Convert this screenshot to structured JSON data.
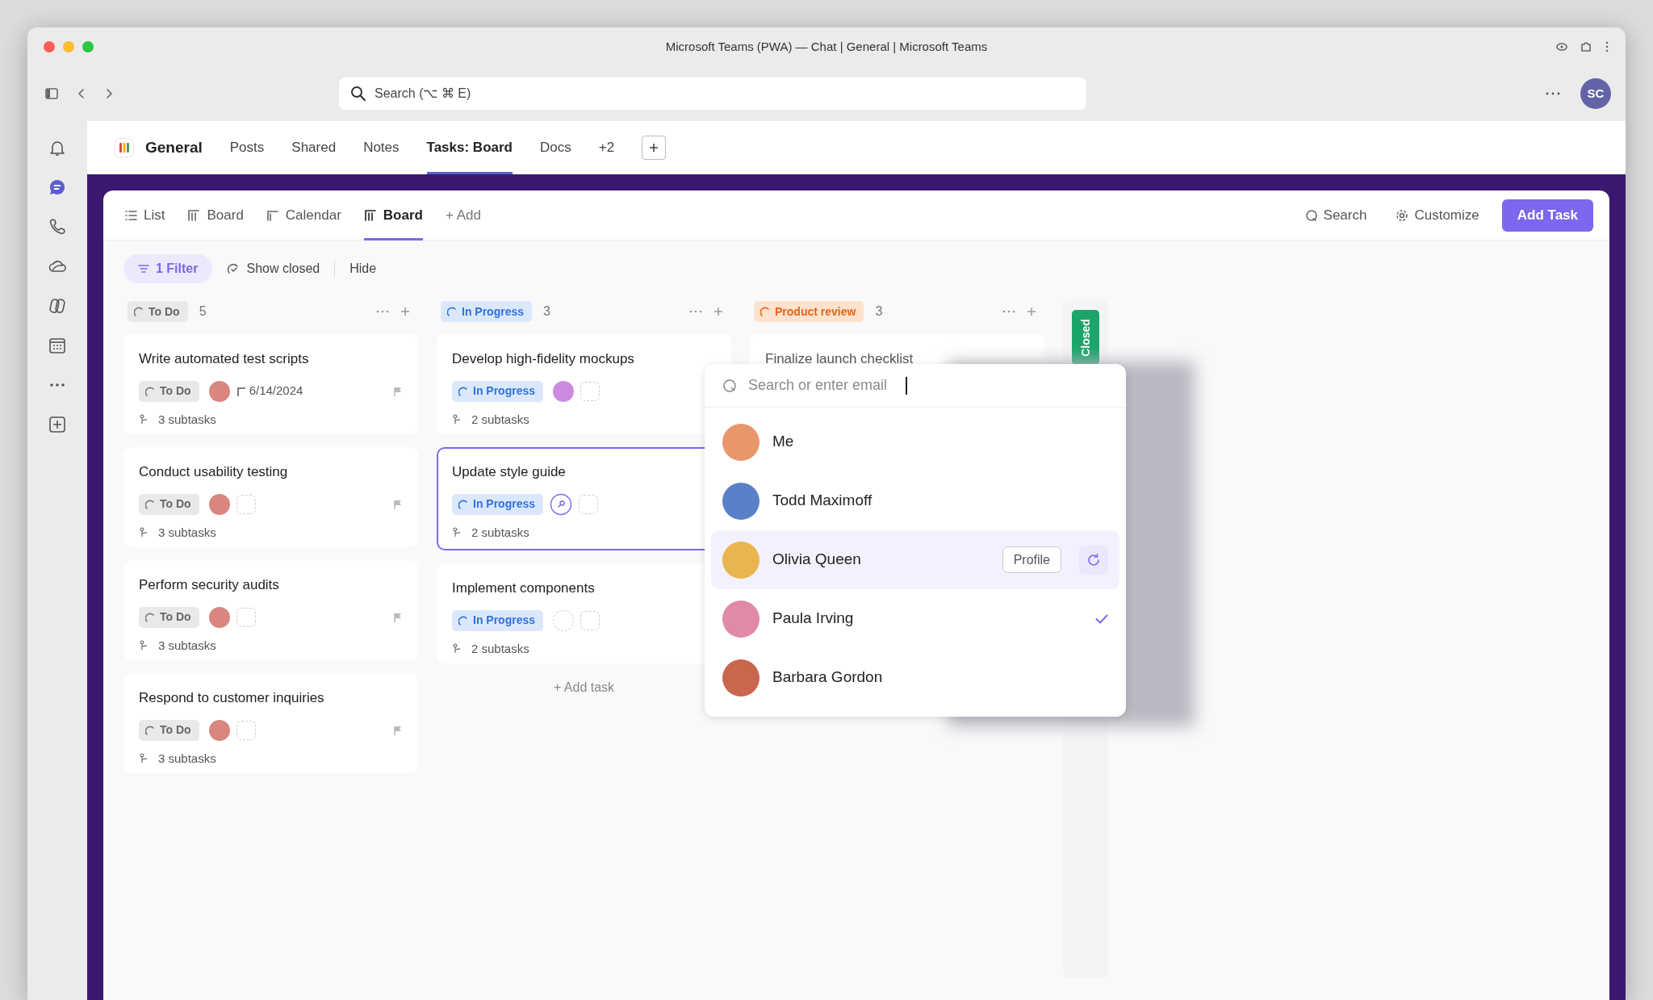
{
  "window": {
    "title": "Microsoft Teams (PWA) — Chat | General | Microsoft Teams"
  },
  "toolbar": {
    "search_placeholder": "Search (⌥ ⌘ E)",
    "avatar": "SC"
  },
  "rail": [
    {
      "kind": "bell",
      "selected": false
    },
    {
      "kind": "chat",
      "selected": true
    },
    {
      "kind": "phone",
      "selected": false
    },
    {
      "kind": "cloud",
      "selected": false
    },
    {
      "kind": "copilot",
      "selected": false
    },
    {
      "kind": "calendar",
      "selected": false
    },
    {
      "kind": "more",
      "selected": false
    },
    {
      "kind": "add",
      "selected": false
    }
  ],
  "channel": {
    "name": "General",
    "tabs": [
      {
        "label": "Posts",
        "selected": false
      },
      {
        "label": "Shared",
        "selected": false
      },
      {
        "label": "Notes",
        "selected": false
      },
      {
        "label": "Tasks: Board",
        "selected": true
      },
      {
        "label": "Docs",
        "selected": false
      },
      {
        "label": "+2",
        "selected": false
      }
    ]
  },
  "views": {
    "tabs": [
      {
        "kind": "list",
        "label": "List",
        "selected": false
      },
      {
        "kind": "board",
        "label": "Board",
        "selected": false
      },
      {
        "kind": "calendar",
        "label": "Calendar",
        "selected": false
      },
      {
        "kind": "board",
        "label": "Board",
        "selected": true
      }
    ],
    "add": "+ Add",
    "search": "Search",
    "customize": "Customize",
    "add_task": "Add Task"
  },
  "filters": {
    "filter": "1 Filter",
    "show_closed": "Show closed",
    "hide": "Hide"
  },
  "columns": [
    {
      "kind": "todo",
      "name": "To Do",
      "count": "5",
      "cards": [
        {
          "title": "Write automated test scripts",
          "status": "To Do",
          "assignee": {
            "kind": "avatar",
            "color": "#d98580"
          },
          "date": "6/14/2024",
          "subtasks": "3 subtasks",
          "flag": true,
          "selected": false
        },
        {
          "title": "Conduct usability testing",
          "status": "To Do",
          "assignee": {
            "kind": "avatar",
            "color": "#d98580"
          },
          "subtasks": "3 subtasks",
          "flag": true,
          "selected": false
        },
        {
          "title": "Perform security audits",
          "status": "To Do",
          "assignee": {
            "kind": "avatar",
            "color": "#d98580"
          },
          "subtasks": "3 subtasks",
          "flag": true,
          "selected": false
        },
        {
          "title": "Respond to customer inquiries",
          "status": "To Do",
          "assignee": {
            "kind": "avatar",
            "color": "#d98580"
          },
          "subtasks": "3 subtasks",
          "flag": true,
          "selected": false
        }
      ]
    },
    {
      "kind": "progress",
      "name": "In Progress",
      "count": "3",
      "add_task": "+ Add task",
      "cards": [
        {
          "title": "Develop high-fidelity mockups",
          "status": "In Progress",
          "assignee": {
            "kind": "avatar",
            "color": "#cc8be0"
          },
          "subtasks": "2 subtasks",
          "flag": false,
          "selected": false
        },
        {
          "title": "Update style guide",
          "status": "In Progress",
          "assignee": {
            "kind": "picker"
          },
          "subtasks": "2 subtasks",
          "flag": false,
          "selected": true
        },
        {
          "title": "Implement components",
          "status": "In Progress",
          "assignee": {
            "kind": "none"
          },
          "subtasks": "2 subtasks",
          "flag": false,
          "selected": false
        }
      ]
    },
    {
      "kind": "review",
      "name": "Product review",
      "count": "3",
      "cards": [
        {
          "title": "Finalize launch checklist",
          "selected": false
        }
      ]
    }
  ],
  "closed_column": {
    "name": "Closed"
  },
  "assignee_menu": {
    "placeholder": "Search or enter email",
    "people": [
      {
        "name": "Me",
        "color": "#e8976a",
        "hovered": false,
        "checked": false
      },
      {
        "name": "Todd Maximoff",
        "color": "#5a80c8",
        "hovered": false,
        "checked": false
      },
      {
        "name": "Olivia Queen",
        "color": "#e8b54e",
        "hovered": true,
        "checked": false,
        "profile_button": "Profile"
      },
      {
        "name": "Paula Irving",
        "color": "#e08aa8",
        "hovered": false,
        "checked": true
      },
      {
        "name": "Barbara Gordon",
        "color": "#c8664e",
        "hovered": false,
        "checked": false
      }
    ]
  }
}
